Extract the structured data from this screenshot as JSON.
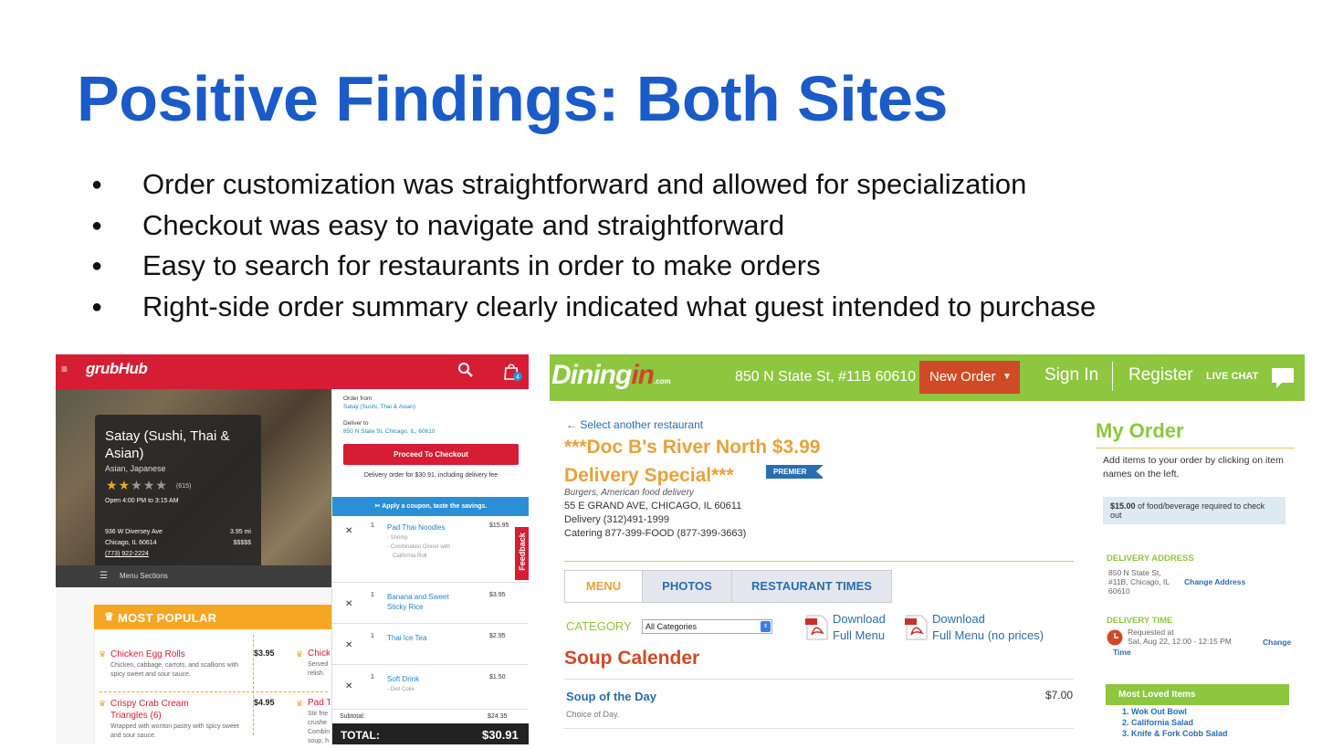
{
  "slide": {
    "title": "Positive Findings: Both Sites",
    "bullets": [
      "Order customization was straightforward and allowed for specialization",
      "Checkout was easy to navigate and straightforward",
      "Easy to search for restaurants in order to make orders",
      "Right-side order summary clearly indicated what guest intended to purchase"
    ]
  },
  "grubhub": {
    "logo": "grubHub",
    "cart_count": "4",
    "restaurant": {
      "name": "Satay (Sushi, Thai & Asian)",
      "cuisine": "Asian, Japanese",
      "rating": 2,
      "rating_count": "(615)",
      "hours": "Open 4:00 PM to 3:15 AM",
      "address_line1": "936 W Diversey Ave",
      "address_line2": "Chicago, IL 60614",
      "phone": "(773) 922-2224",
      "distance": "3.95 mi",
      "price_level": "$$$$$"
    },
    "menu_sections_label": "Menu Sections",
    "most_popular_label": "MOST POPULAR",
    "menu_items": [
      {
        "name": "Chicken Egg Rolls",
        "desc": "Chicken, cabbage, carrots, and scallions with spicy sweet and sour sauce.",
        "price": "$3.95"
      },
      {
        "name": "Crispy Crab Cream Triangles (6)",
        "desc": "Wrapped with wonton pastry with spicy sweet and sour sauce.",
        "price": "$4.95"
      },
      {
        "name": "Chick",
        "desc": "Served relish."
      },
      {
        "name": "Pad T",
        "desc": "Stir frie crushe Combin soup, h"
      }
    ],
    "cart": {
      "order_from_label": "Order from",
      "order_from_value": "Satay (Sushi, Thai & Asian)",
      "deliver_to_label": "Deliver to",
      "deliver_to_value": "850 N State St, Chicago, IL, 60610",
      "checkout_button": "Proceed To Checkout",
      "delivery_note": "Delivery order for $30.91, including delivery fee",
      "coupon_banner": "Apply a coupon, taste the savings.",
      "feedback_label": "Feedback",
      "items": [
        {
          "qty": "1",
          "name": "Pad Thai Noodles",
          "subs": [
            "- Shrimp",
            "- Combination Dinner with",
            "California Roll"
          ],
          "price": "$15.95"
        },
        {
          "qty": "1",
          "name": "Banana and Sweet Sticky Rice",
          "subs": [],
          "price": "$3.95"
        },
        {
          "qty": "1",
          "name": "Thai Ice Tea",
          "subs": [],
          "price": "$2.95"
        },
        {
          "qty": "1",
          "name": "Soft Drink",
          "subs": [
            "- Diet Coke"
          ],
          "price": "$1.50"
        }
      ],
      "subtotal_label": "Subtotal:",
      "subtotal_value": "$24.35",
      "total_label": "TOTAL:",
      "total_value": "$30.91"
    }
  },
  "diningin": {
    "logo_main": "Dining",
    "logo_in": "in",
    "logo_com": ".com",
    "address": "850 N State St, #11B 60610",
    "new_order": "New Order",
    "sign_in": "Sign In",
    "register": "Register",
    "live_chat": "LIVE CHAT",
    "back_link": "Select another restaurant",
    "restaurant_name": "***Doc B's River North $3.99 Delivery Special***",
    "premier_badge": "PREMIER",
    "subtitle": "Burgers, American food delivery",
    "address_line": "55 E GRAND AVE, CHICAGO, IL 60611",
    "delivery_phone": "Delivery (312)491-1999",
    "catering_phone": "Catering 877-399-FOOD (877-399-3663)",
    "tabs": [
      "MENU",
      "PHOTOS",
      "RESTAURANT TIMES"
    ],
    "category_label": "CATEGORY",
    "category_value": "All Categories",
    "download_menu": [
      "Download",
      "Full Menu"
    ],
    "download_menu_noprice": [
      "Download",
      "Full Menu (no prices)"
    ],
    "section_title": "Soup Calender",
    "item_name": "Soup of the Day",
    "item_price": "$7.00",
    "item_desc": "Choice of Day.",
    "my_order": {
      "title": "My Order",
      "instructions": "Add items to your order by clicking on item names on the left.",
      "minimum_amount": "$15.00",
      "minimum_text": " of food/beverage required to check out",
      "delivery_address_label": "DELIVERY ADDRESS",
      "delivery_address": [
        "850 N State St,",
        "#11B, Chicago, IL",
        "60610"
      ],
      "change_address": "Change Address",
      "delivery_time_label": "DELIVERY TIME",
      "requested_label": "Requested at",
      "requested_value": "Sat, Aug 22, 12:00 - 12:15 PM",
      "change_time": [
        "Change",
        "Time"
      ],
      "most_loved_label": "Most Loved Items",
      "most_loved": [
        "1. Wok Out Bowl",
        "2. California Salad",
        "3. Knife & Fork Cobb Salad"
      ]
    }
  }
}
